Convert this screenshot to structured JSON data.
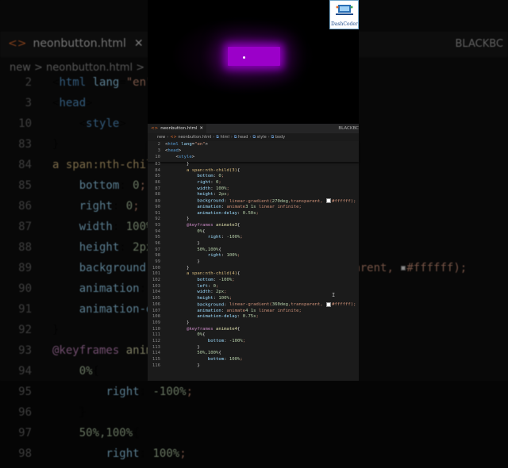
{
  "backdrop": {
    "tab_label": "neonbutton.html",
    "tab_close": "✕",
    "right_label": "BLACKBC",
    "breadcrumb": "new > neonbutton.html > html > head > style > body",
    "lines": [
      {
        "n": "2",
        "t": "<html lang=\"en\">"
      },
      {
        "n": "3",
        "t": "<head>"
      },
      {
        "n": "10",
        "t": "    <style>"
      },
      {
        "n": "83",
        "t": "}"
      },
      {
        "n": "84",
        "t": "a span:nth-child(3){"
      },
      {
        "n": "85",
        "t": "    bottom: 0;"
      },
      {
        "n": "86",
        "t": "    right: 0;"
      },
      {
        "n": "87",
        "t": "    width: 100%;"
      },
      {
        "n": "88",
        "t": "    height: 2px;"
      },
      {
        "n": "89",
        "t": "    background: linear-gradient(270deg,transparent, #ffffff);"
      },
      {
        "n": "90",
        "t": "    animation: animate3 1s linear infinite;"
      },
      {
        "n": "91",
        "t": "    animation-delay: 0.50s;"
      },
      {
        "n": "92",
        "t": "}"
      },
      {
        "n": "93",
        "t": "@keyframes animate3{"
      },
      {
        "n": "94",
        "t": "    0%{"
      },
      {
        "n": "95",
        "t": "        right: -100%;"
      },
      {
        "n": "96",
        "t": "    }"
      },
      {
        "n": "97",
        "t": "    50%,100%{"
      },
      {
        "n": "98",
        "t": "        right: 100%;"
      }
    ]
  },
  "logo": {
    "text": "DashCoder"
  },
  "editor": {
    "tab_label": "neonbutton.html",
    "tab_close": "✕",
    "right_label": "BLACKBC",
    "breadcrumb": [
      {
        "icon": "folder",
        "label": "new"
      },
      {
        "icon": "html-file-icon",
        "label": "neonbutton.html"
      },
      {
        "icon": "tag-icon",
        "label": "html"
      },
      {
        "icon": "tag-icon",
        "label": "head"
      },
      {
        "icon": "tag-icon",
        "label": "style"
      },
      {
        "icon": "tag-icon",
        "label": "body"
      }
    ],
    "sticky_lines": [
      {
        "n": "2",
        "t": "<html lang=\"en\">"
      },
      {
        "n": "3",
        "t": "<head>"
      },
      {
        "n": "10",
        "t": "    <style>"
      }
    ],
    "lines": [
      {
        "n": "83",
        "t": "        }"
      },
      {
        "n": "84",
        "t": "        a span:nth-child(3){"
      },
      {
        "n": "85",
        "t": "            bottom: 0;"
      },
      {
        "n": "86",
        "t": "            right: 0;"
      },
      {
        "n": "87",
        "t": "            width: 100%;"
      },
      {
        "n": "88",
        "t": "            height: 2px;"
      },
      {
        "n": "89",
        "t": "            background: linear-gradient(270deg,transparent, #ffffff);"
      },
      {
        "n": "90",
        "t": "            animation: animate3 1s linear infinite;"
      },
      {
        "n": "91",
        "t": "            animation-delay: 0.50s;"
      },
      {
        "n": "92",
        "t": "        }"
      },
      {
        "n": "93",
        "t": "        @keyframes animate3{"
      },
      {
        "n": "94",
        "t": "            0%{"
      },
      {
        "n": "95",
        "t": "                right: -100%;"
      },
      {
        "n": "96",
        "t": "            }"
      },
      {
        "n": "97",
        "t": "            50%,100%{"
      },
      {
        "n": "98",
        "t": "                right: 100%;"
      },
      {
        "n": "99",
        "t": "            }"
      },
      {
        "n": "100",
        "t": "        }"
      },
      {
        "n": "101",
        "t": "        a span:nth-child(4){"
      },
      {
        "n": "102",
        "t": "            bottom: -100%;"
      },
      {
        "n": "103",
        "t": "            left: 0;"
      },
      {
        "n": "104",
        "t": "            width: 2px;"
      },
      {
        "n": "105",
        "t": "            height: 100%;"
      },
      {
        "n": "106",
        "t": "            background: linear-gradient(360deg,transparent, #ffffff);"
      },
      {
        "n": "107",
        "t": "            animation: animate4 1s linear infinite;"
      },
      {
        "n": "108",
        "t": "            animation-delay: 0.75s;"
      },
      {
        "n": "109",
        "t": "        }"
      },
      {
        "n": "110",
        "t": "        @keyframes animate4{"
      },
      {
        "n": "111",
        "t": "            0%{"
      },
      {
        "n": "112",
        "t": "                bottom: -100%;"
      },
      {
        "n": "113",
        "t": "            }"
      },
      {
        "n": "114",
        "t": "            50%,100%{"
      },
      {
        "n": "115",
        "t": "                bottom: 100%;"
      },
      {
        "n": "116",
        "t": "            }"
      }
    ]
  },
  "colors": {
    "neon": "#9b00c9",
    "accent": "#e06c2c"
  }
}
